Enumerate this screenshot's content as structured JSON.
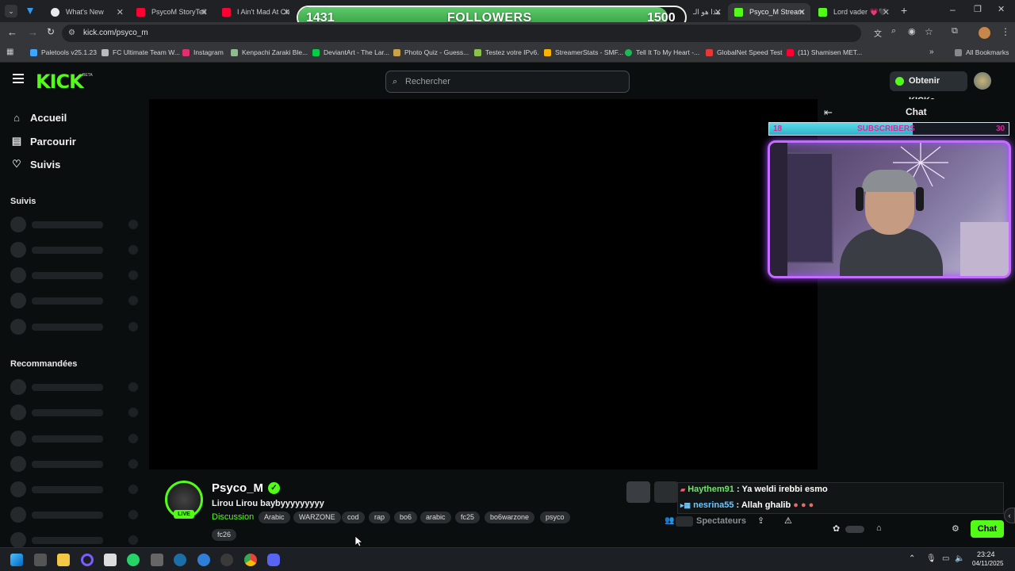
{
  "browser": {
    "tabs": [
      {
        "label": "What's New",
        "color": "#e8eaed"
      },
      {
        "label": "PsycoM StoryTell",
        "color": "#ff0033"
      },
      {
        "label": "I Ain't Mad At Ch",
        "color": "#ff0033"
      },
      {
        "label": "هذا هو الـ",
        "color": "#3ea6ff"
      },
      {
        "label": "Psyco_M Stream",
        "color": "#53fc18"
      },
      {
        "label": "Lord vader 💗🖤",
        "color": "#53fc18"
      }
    ],
    "url": "kick.com/psyco_m",
    "bookmarks": [
      {
        "label": "Paletools v25.1.23",
        "color": "#3ea6ff"
      },
      {
        "label": "FC Ultimate Team W...",
        "color": "#bbbbbb"
      },
      {
        "label": "Instagram",
        "color": "#e1306c"
      },
      {
        "label": "Kenpachi Zaraki Ble...",
        "color": "#8fbc8f"
      },
      {
        "label": "DeviantArt - The Lar...",
        "color": "#05cc47"
      },
      {
        "label": "Photo Quiz - Guess...",
        "color": "#c8a14a"
      },
      {
        "label": "Testez votre IPv6.",
        "color": "#8bc34a"
      },
      {
        "label": "StreamerStats - SMF...",
        "color": "#ffb300"
      },
      {
        "label": "Tell It To My Heart -...",
        "color": "#1db954"
      },
      {
        "label": "GlobalNet Speed Test",
        "color": "#e53935"
      },
      {
        "label": "(11) Shamisen MET...",
        "color": "#ff0033"
      }
    ],
    "all_bookmarks": "All Bookmarks"
  },
  "followers_goal": {
    "current": "1431",
    "label": "FOLLOWERS",
    "target": "1500",
    "progress": 0.954
  },
  "header": {
    "logo": "KICK",
    "logo_badge": "BETA",
    "search_placeholder": "Rechercher",
    "get_kicks": "Obtenir KICKs"
  },
  "sidebar": {
    "nav": [
      {
        "label": "Accueil",
        "icon": "home-icon"
      },
      {
        "label": "Parcourir",
        "icon": "browse-icon"
      },
      {
        "label": "Suivis",
        "icon": "heart-icon"
      }
    ],
    "followed_title": "Suivis",
    "recommended_title": "Recommandées"
  },
  "chat": {
    "title": "Chat",
    "subs_goal": {
      "current": "18",
      "label": "SUBSCRIBERS",
      "target": "30",
      "progress": 0.6
    },
    "messages": [
      {
        "user": "Haythem91",
        "sep": ":",
        "text": "Ya weldi irebbi esmo",
        "user_color": "#72e36c"
      },
      {
        "user": "nesrina55",
        "sep": ":",
        "text": "Allah ghalib",
        "user_color": "#6ec8ff"
      }
    ],
    "chat_button": "Chat"
  },
  "channel": {
    "name": "Psyco_M",
    "title": "Lirou Lirou baybyyyyyyyyy",
    "category": "Discussion",
    "live_badge": "LIVE",
    "viewers_label": "Spectateurs",
    "tags": [
      "Arabic",
      "WARZONE",
      "cod",
      "rap",
      "bo6",
      "arabic",
      "fc25",
      "bo6warzone",
      "psyco",
      "fc26"
    ]
  },
  "taskbar": {
    "time": "23:24",
    "date": "04/11/2025"
  },
  "colors": {
    "accent": "#53fc18",
    "bg": "#0b0e0f"
  }
}
